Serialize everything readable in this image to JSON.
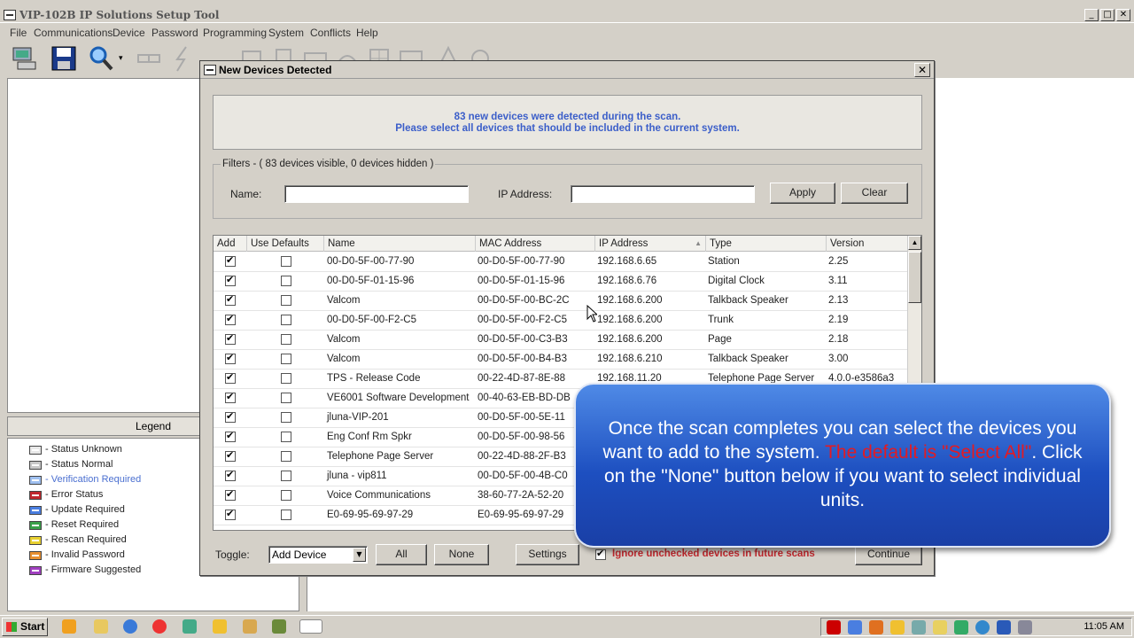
{
  "app": {
    "title": "VIP-102B IP Solutions Setup Tool",
    "menu": [
      "File",
      "Communications",
      "Device",
      "Password",
      "Programming",
      "System",
      "Conflicts",
      "Help"
    ]
  },
  "legend": {
    "header": "Legend",
    "items": [
      {
        "label": "- Status Unknown",
        "color": "#e8e8e8",
        "text_color": "#222"
      },
      {
        "label": "- Status Normal",
        "color": "#c8c8c8",
        "text_color": "#222"
      },
      {
        "label": "- Verification Required",
        "color": "#9fc0f0",
        "text_color": "#4a6fd0"
      },
      {
        "label": "- Error Status",
        "color": "#c0282e",
        "text_color": "#222"
      },
      {
        "label": "- Update Required",
        "color": "#4a7ee0",
        "text_color": "#222"
      },
      {
        "label": "- Reset Required",
        "color": "#3aa14a",
        "text_color": "#222"
      },
      {
        "label": "- Rescan Required",
        "color": "#e8d030",
        "text_color": "#222"
      },
      {
        "label": "- Invalid Password",
        "color": "#e89030",
        "text_color": "#222"
      },
      {
        "label": "- Firmware Suggested",
        "color": "#a040c0",
        "text_color": "#222"
      }
    ]
  },
  "dialog": {
    "title": "New Devices Detected",
    "message_line1": "83 new devices were detected during the scan.",
    "message_line2": "Please select all devices that should be included in the current system.",
    "filters": {
      "legend": "Filters - ( 83 devices visible, 0 devices hidden )",
      "name_label": "Name:",
      "name_value": "",
      "ip_label": "IP Address:",
      "ip_value": "",
      "apply_label": "Apply",
      "clear_label": "Clear"
    },
    "columns": [
      "Add",
      "Use Defaults",
      "Name",
      "MAC Address",
      "IP Address",
      "Type",
      "Version"
    ],
    "rows": [
      {
        "add": true,
        "defaults": false,
        "name": "00-D0-5F-00-77-90",
        "mac": "00-D0-5F-00-77-90",
        "ip": "192.168.6.65",
        "type": "Station",
        "version": "2.25"
      },
      {
        "add": true,
        "defaults": false,
        "name": "00-D0-5F-01-15-96",
        "mac": "00-D0-5F-01-15-96",
        "ip": "192.168.6.76",
        "type": "Digital Clock",
        "version": "3.11"
      },
      {
        "add": true,
        "defaults": false,
        "name": "Valcom",
        "mac": "00-D0-5F-00-BC-2C",
        "ip": "192.168.6.200",
        "type": "Talkback Speaker",
        "version": "2.13"
      },
      {
        "add": true,
        "defaults": false,
        "name": "00-D0-5F-00-F2-C5",
        "mac": "00-D0-5F-00-F2-C5",
        "ip": "192.168.6.200",
        "type": "Trunk",
        "version": "2.19"
      },
      {
        "add": true,
        "defaults": false,
        "name": "Valcom",
        "mac": "00-D0-5F-00-C3-B3",
        "ip": "192.168.6.200",
        "type": "Page",
        "version": "2.18"
      },
      {
        "add": true,
        "defaults": false,
        "name": "Valcom",
        "mac": "00-D0-5F-00-B4-B3",
        "ip": "192.168.6.210",
        "type": "Talkback Speaker",
        "version": "3.00"
      },
      {
        "add": true,
        "defaults": false,
        "name": "TPS - Release Code",
        "mac": "00-22-4D-87-8E-88",
        "ip": "192.168.11.20",
        "type": "Telephone Page Server",
        "version": "4.0.0-e3586a3"
      },
      {
        "add": true,
        "defaults": false,
        "name": "VE6001 Software Development",
        "mac": "00-40-63-EB-BD-DB",
        "ip": "",
        "type": "",
        "version": ""
      },
      {
        "add": true,
        "defaults": false,
        "name": "jluna-VIP-201",
        "mac": "00-D0-5F-00-5E-11",
        "ip": "",
        "type": "",
        "version": ""
      },
      {
        "add": true,
        "defaults": false,
        "name": "Eng Conf Rm Spkr",
        "mac": "00-D0-5F-00-98-56",
        "ip": "",
        "type": "",
        "version": ""
      },
      {
        "add": true,
        "defaults": false,
        "name": "Telephone Page Server",
        "mac": "00-22-4D-88-2F-B3",
        "ip": "",
        "type": "",
        "version": ""
      },
      {
        "add": true,
        "defaults": false,
        "name": "jluna - vip811",
        "mac": "00-D0-5F-00-4B-C0",
        "ip": "",
        "type": "",
        "version": ""
      },
      {
        "add": true,
        "defaults": false,
        "name": "Voice Communications",
        "mac": "38-60-77-2A-52-20",
        "ip": "",
        "type": "",
        "version": ""
      },
      {
        "add": true,
        "defaults": false,
        "name": "E0-69-95-69-97-29",
        "mac": "E0-69-95-69-97-29",
        "ip": "",
        "type": "",
        "version": ""
      }
    ],
    "footer": {
      "toggle_label": "Toggle:",
      "toggle_value": "Add Device",
      "all_label": "All",
      "none_label": "None",
      "settings_label": "Settings",
      "ignore_label": "Ignore unchecked devices in future scans",
      "ignore_checked": true,
      "continue_label": "Continue"
    }
  },
  "callout": {
    "text_a": "Once the scan completes you can select the devices you want to add to the system.",
    "text_red": "The default is \"Select All\"",
    "text_b": ". Click on the \"None\" button below if you want to select individual units."
  },
  "taskbar": {
    "start_label": "Start",
    "clock": "11:05 AM"
  }
}
